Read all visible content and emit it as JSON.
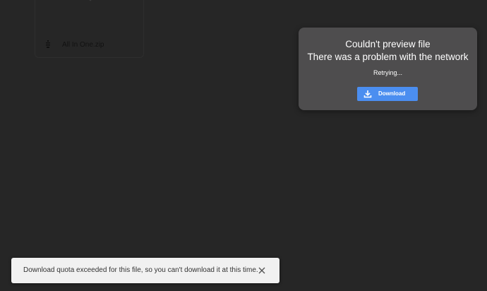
{
  "file_card": {
    "file_name": "All In One.zip",
    "icon": "zip-file-icon"
  },
  "preview_dialog": {
    "title": "Couldn't preview file",
    "subtitle": "There was a problem with the network",
    "status": "Retrying...",
    "download_label": "Download",
    "download_icon": "download-icon",
    "accent_color": "#4b8ef0",
    "background_color": "#4e4d4e"
  },
  "snackbar": {
    "message": "Download quota exceeded for this file, so you can't download it at this time.",
    "close_icon": "close-icon"
  }
}
